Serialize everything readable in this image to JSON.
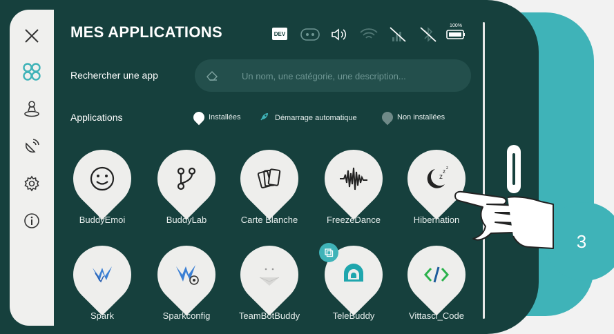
{
  "header": {
    "title": "MES APPLICATIONS",
    "dev_badge": "DEV",
    "battery_text": "100%"
  },
  "search": {
    "label": "Rechercher une app",
    "placeholder": "Un nom, une catégorie, une description..."
  },
  "section": {
    "label": "Applications",
    "legend": [
      {
        "label": "Installées",
        "icon": "installed-dot"
      },
      {
        "label": "Démarrage automatique",
        "icon": "rocket-icon"
      },
      {
        "label": "Non installées",
        "icon": "not-installed-dot"
      }
    ]
  },
  "apps": [
    {
      "label": "BuddyEmoi",
      "icon": "smiley-icon"
    },
    {
      "label": "BuddyLab",
      "icon": "branch-icon"
    },
    {
      "label": "Carte Blanche",
      "icon": "cards-icon"
    },
    {
      "label": "FreezeDance",
      "icon": "waveform-icon"
    },
    {
      "label": "Hibernation",
      "icon": "moon-sleep-icon"
    },
    {
      "label": "Spark",
      "icon": "spark-icon"
    },
    {
      "label": "Sparkconfig",
      "icon": "sparkconfig-icon"
    },
    {
      "label": "TeamBotBuddy",
      "icon": "teambot-icon"
    },
    {
      "label": "TeleBuddy",
      "icon": "telebuddy-icon"
    },
    {
      "label": "Vittasci_Code",
      "icon": "code-icon"
    }
  ],
  "step_badge": "3",
  "colors": {
    "device_bg": "#16403d",
    "accent": "#3fb3b8",
    "tile": "#eeeeec"
  }
}
